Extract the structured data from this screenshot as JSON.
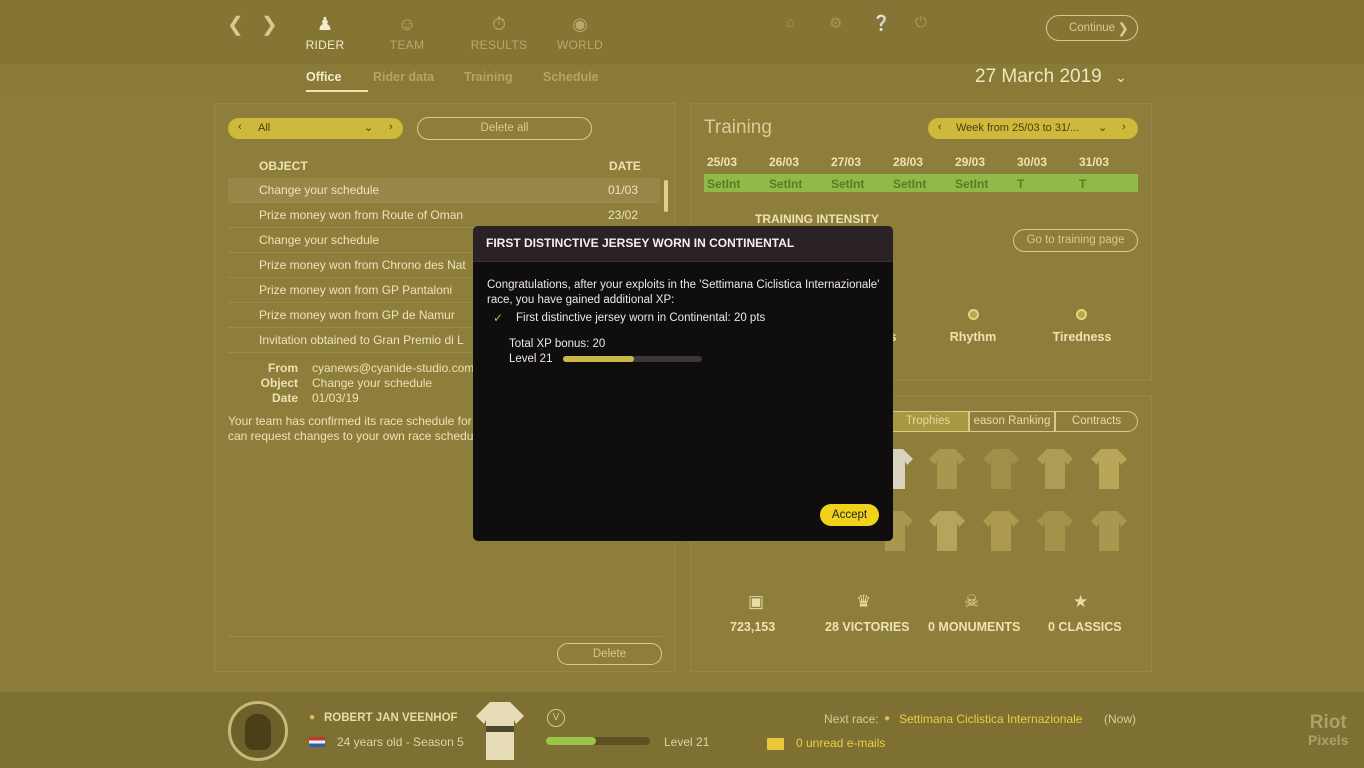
{
  "nav": {
    "back_icon": "chevron-left-icon",
    "forward_icon": "chevron-right-icon",
    "tabs": [
      {
        "label": "RIDER",
        "icon": "person-icon"
      },
      {
        "label": "TEAM",
        "icon": "team-icon"
      },
      {
        "label": "RESULTS",
        "icon": "stopwatch-icon"
      },
      {
        "label": "WORLD",
        "icon": "globe-icon"
      }
    ],
    "subtabs": [
      "Office",
      "Rider data",
      "Training",
      "Schedule"
    ],
    "utility_icons": [
      "home-icon",
      "gear-icon",
      "help-icon",
      "power-icon"
    ],
    "continue_label": "Continue",
    "date": "27 March 2019"
  },
  "mail": {
    "filter": "All",
    "delete_all": "Delete all",
    "col_object": "OBJECT",
    "col_date": "DATE",
    "rows": [
      {
        "object": "Change your schedule",
        "date": "01/03"
      },
      {
        "object": "Prize money won from Route of Oman",
        "date": "23/02"
      },
      {
        "object": "Change your schedule",
        "date": ""
      },
      {
        "object": "Prize money won from Chrono des Nat",
        "date": ""
      },
      {
        "object": "Prize money won from GP Pantaloni",
        "date": ""
      },
      {
        "object": "Prize money won from GP de Namur",
        "date": ""
      },
      {
        "object": "Invitation obtained to Gran Premio di L",
        "date": ""
      }
    ],
    "detail": {
      "from_label": "From",
      "from": "cyanews@cyanide-studio.com",
      "object_label": "Object",
      "object": "Change your schedule",
      "date_label": "Date",
      "date": "01/03/19",
      "body1": "Your team has confirmed its race schedule for",
      "body2": "can request changes to your own race schedule"
    },
    "delete": "Delete"
  },
  "training": {
    "title": "Training",
    "week": "Week from 25/03 to 31/...",
    "days": [
      "25/03",
      "26/03",
      "27/03",
      "28/03",
      "29/03",
      "30/03",
      "31/03"
    ],
    "plan": [
      "SetInt",
      "SetInt",
      "SetInt",
      "SetInt",
      "SetInt",
      "T",
      "T"
    ],
    "intensity_label": "TRAINING INTENSITY",
    "goto": "Go to training page",
    "stats": [
      "s",
      "Rhythm",
      "Tiredness"
    ]
  },
  "career": {
    "tabs": [
      "Trophies",
      "eason Ranking",
      "Contracts"
    ],
    "money": "723,153",
    "victories": "28 VICTORIES",
    "monuments": "0 MONUMENTS",
    "classics": "0 CLASSICS"
  },
  "dialog": {
    "title": "FIRST DISTINCTIVE JERSEY WORN IN CONTINENTAL",
    "line1": "Congratulations, after your exploits in the 'Settimana Ciclistica Internazionale'",
    "line2": "race, you have gained additional XP:",
    "item": "First distinctive jersey worn in Continental: 20 pts",
    "total": "Total XP bonus: 20",
    "level": "Level 21",
    "xp_progress": 0.51,
    "accept": "Accept"
  },
  "footer": {
    "rider_name": "ROBERT JAN VEENHOF",
    "rider_info": "24 years old - Season 5",
    "level": "Level 21",
    "level_progress": 0.48,
    "next_race_label": "Next race:",
    "next_race": "Settimana Ciclistica Internazionale",
    "next_race_suffix": "(Now)",
    "emails": "0 unread e-mails",
    "watermark1": "Riot",
    "watermark2": "Pixels"
  }
}
